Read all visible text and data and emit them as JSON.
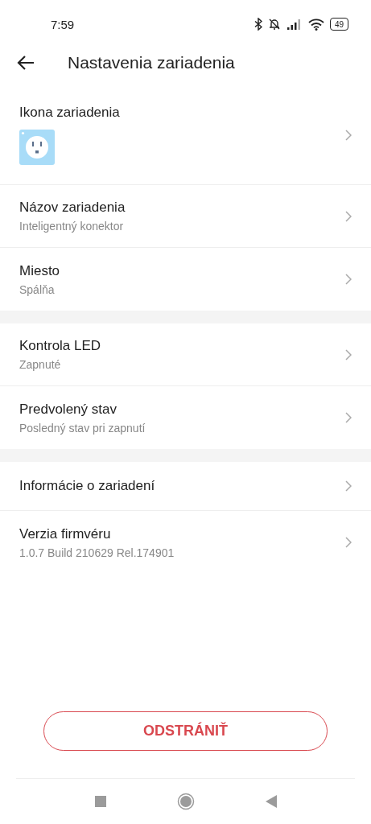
{
  "status_bar": {
    "time": "7:59",
    "battery": "49"
  },
  "header": {
    "title": "Nastavenia zariadenia"
  },
  "sections": [
    {
      "items": [
        {
          "kind": "icon",
          "title": "Ikona zariadenia"
        },
        {
          "kind": "text",
          "title": "Názov zariadenia",
          "subtitle": "Inteligentný konektor"
        },
        {
          "kind": "text",
          "title": "Miesto",
          "subtitle": "Spálňa"
        }
      ]
    },
    {
      "items": [
        {
          "kind": "text",
          "title": "Kontrola LED",
          "subtitle": "Zapnuté"
        },
        {
          "kind": "text",
          "title": "Predvolený stav",
          "subtitle": "Posledný stav pri zapnutí"
        }
      ]
    },
    {
      "items": [
        {
          "kind": "plain",
          "title": "Informácie o zariadení"
        },
        {
          "kind": "text",
          "title": "Verzia firmvéru",
          "subtitle": "1.0.7 Build 210629 Rel.174901"
        }
      ]
    }
  ],
  "remove_button": {
    "label": "ODSTRÁNIŤ"
  }
}
